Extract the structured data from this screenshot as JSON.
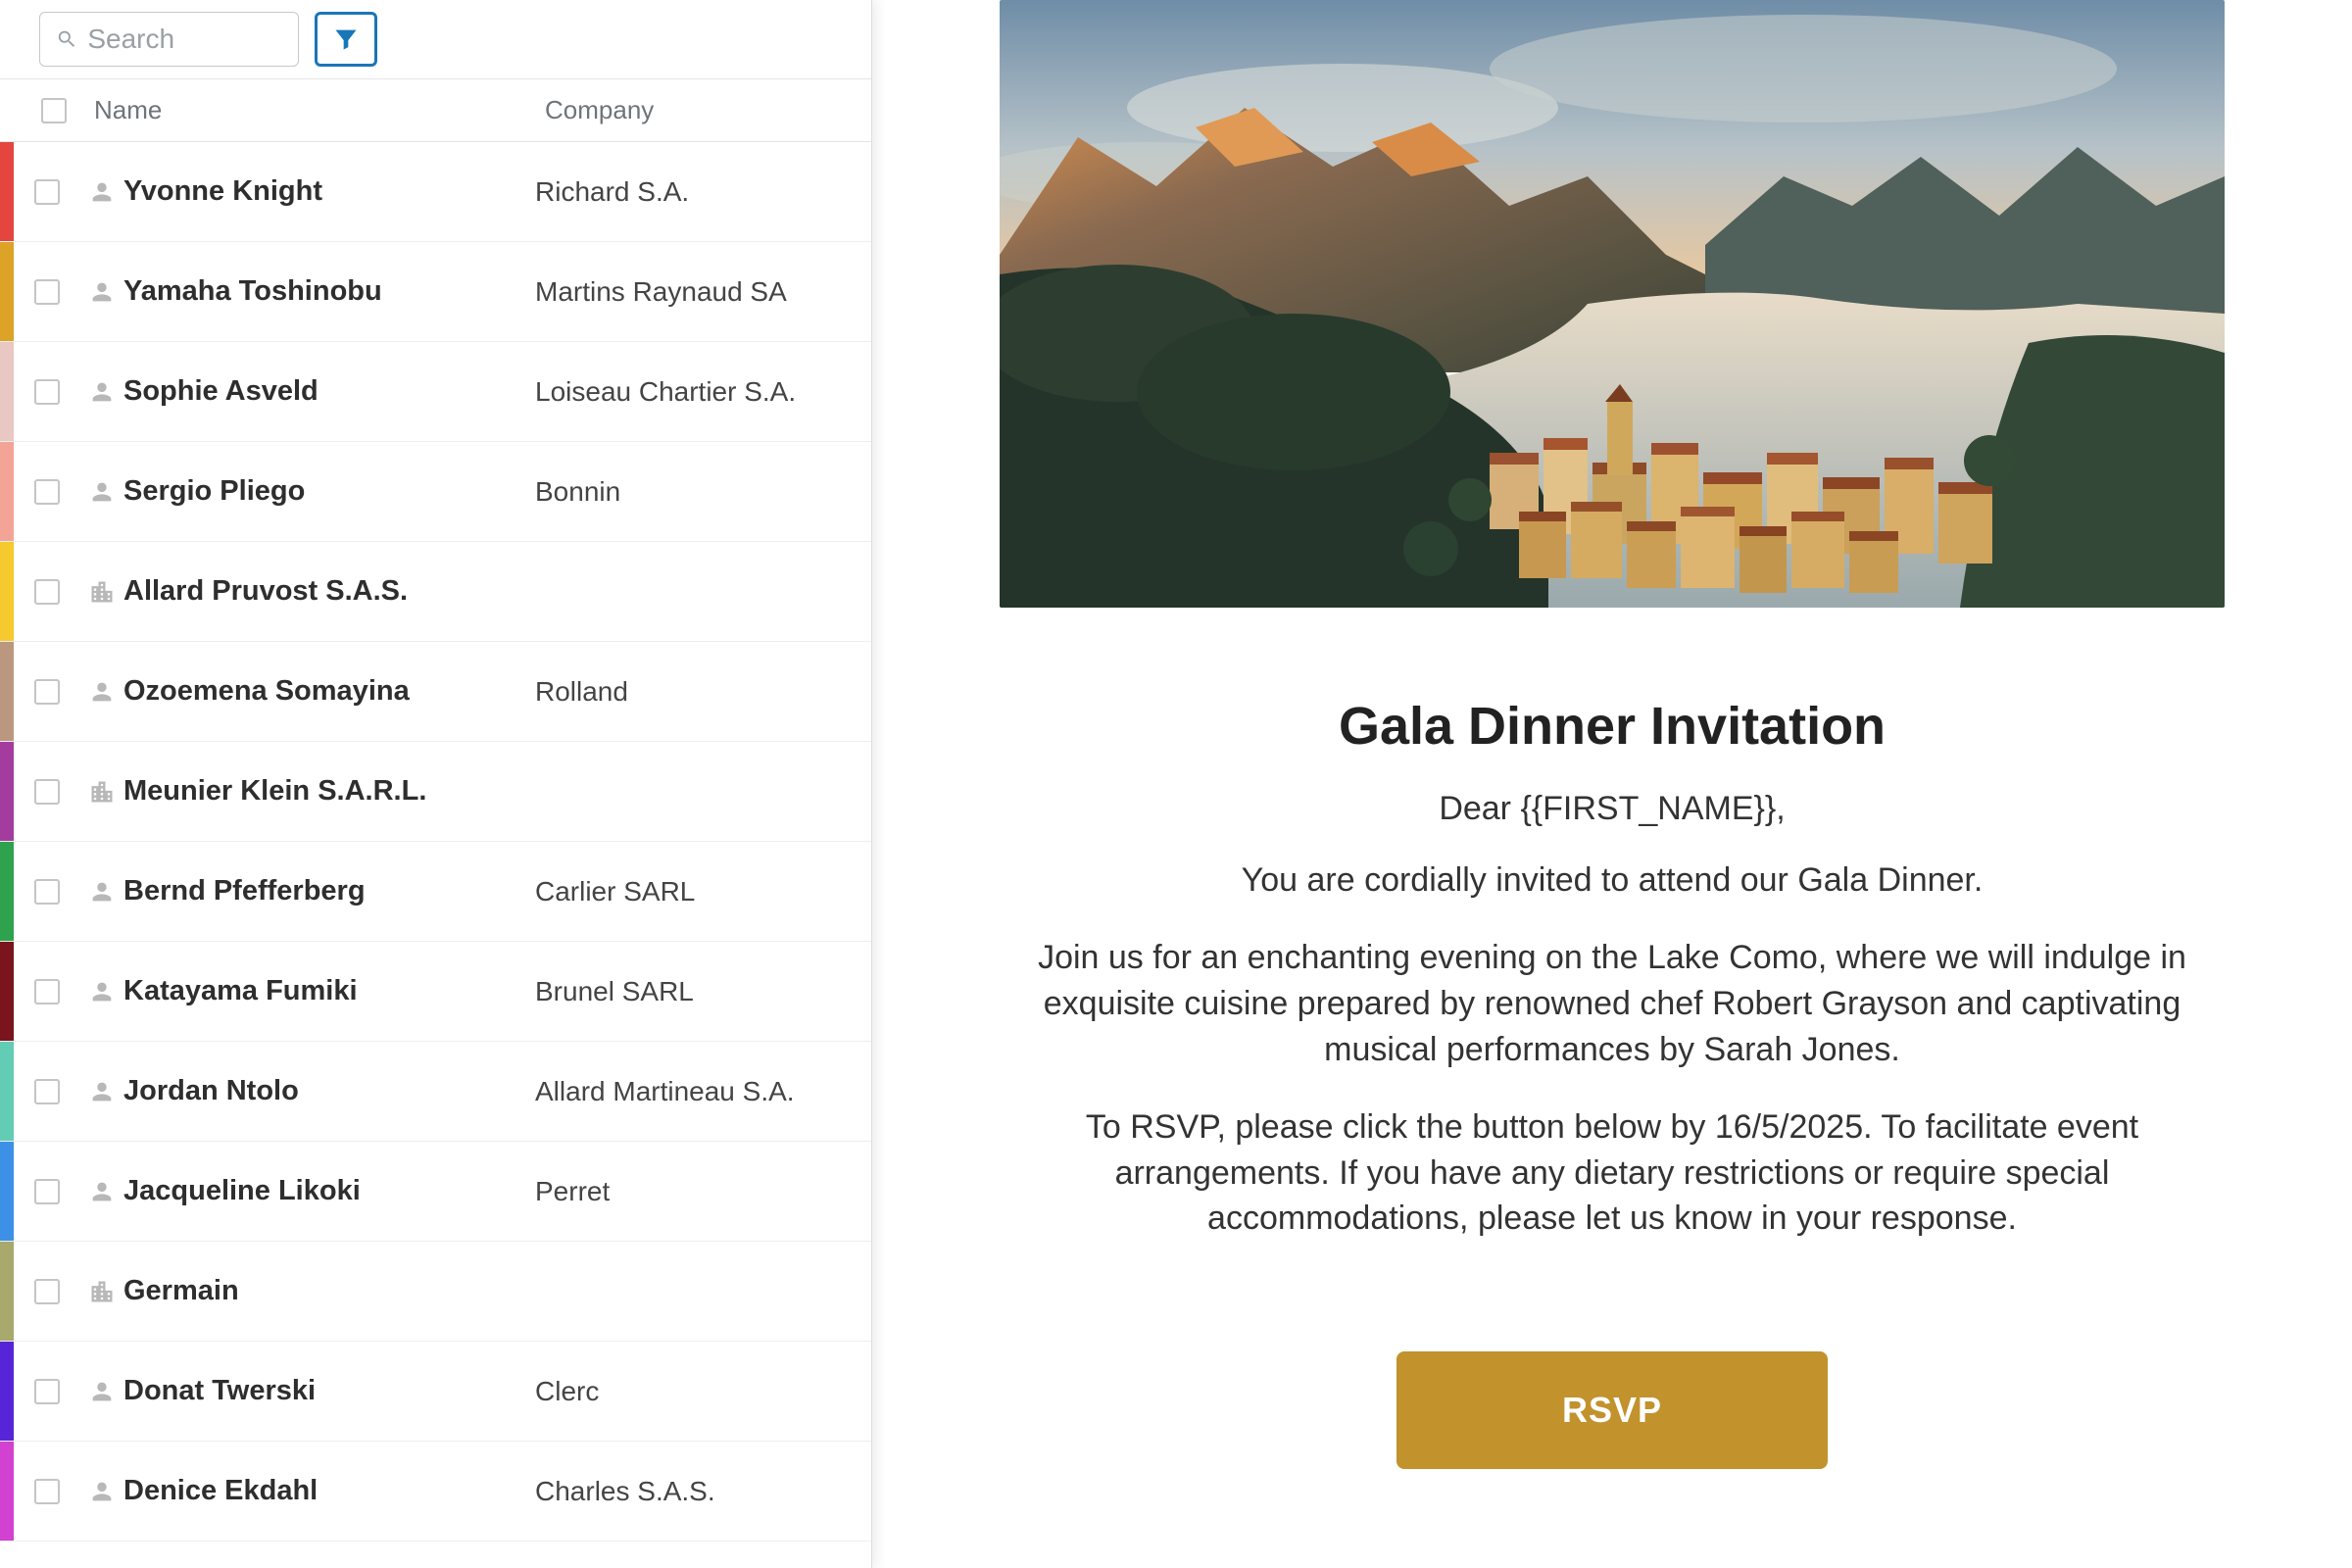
{
  "search": {
    "placeholder": "Search"
  },
  "headers": {
    "name": "Name",
    "company": "Company"
  },
  "contacts": [
    {
      "name": "Yvonne Knight",
      "company": "Richard S.A.",
      "color": "#e4453f",
      "type": "person"
    },
    {
      "name": "Yamaha Toshinobu",
      "company": "Martins Raynaud SA",
      "color": "#dca326",
      "type": "person"
    },
    {
      "name": "Sophie Asveld",
      "company": "Loiseau Chartier S.A.",
      "color": "#e9c7c2",
      "type": "person"
    },
    {
      "name": "Sergio Pliego",
      "company": "Bonnin",
      "color": "#f4a496",
      "type": "person"
    },
    {
      "name": "Allard Pruvost S.A.S.",
      "company": "",
      "color": "#f6c92f",
      "type": "company"
    },
    {
      "name": "Ozoemena Somayina",
      "company": "Rolland",
      "color": "#ba977e",
      "type": "person"
    },
    {
      "name": "Meunier Klein S.A.R.L.",
      "company": "",
      "color": "#a43ca0",
      "type": "company"
    },
    {
      "name": "Bernd Pfefferberg",
      "company": "Carlier SARL",
      "color": "#2fa24d",
      "type": "person"
    },
    {
      "name": "Katayama Fumiki",
      "company": "Brunel SARL",
      "color": "#7a141d",
      "type": "person"
    },
    {
      "name": "Jordan Ntolo",
      "company": "Allard Martineau S.A.",
      "color": "#63ccb5",
      "type": "person"
    },
    {
      "name": "Jacqueline Likoki",
      "company": "Perret",
      "color": "#3c90e6",
      "type": "person"
    },
    {
      "name": "Germain",
      "company": "",
      "color": "#a9a86d",
      "type": "company"
    },
    {
      "name": "Donat Twerski",
      "company": "Clerc",
      "color": "#5625d7",
      "type": "person"
    },
    {
      "name": "Denice Ekdahl",
      "company": "Charles S.A.S.",
      "color": "#d241cf",
      "type": "person"
    }
  ],
  "email": {
    "title": "Gala Dinner Invitation",
    "greeting": "Dear {{FIRST_NAME}},",
    "p1": "You are cordially invited to attend our Gala Dinner.",
    "p2": "Join us for an enchanting evening on the Lake Como, where we will indulge in exquisite cuisine prepared by renowned chef Robert Grayson and captivating musical performances by Sarah Jones.",
    "p3": "To RSVP, please click the button below by 16/5/2025. To facilitate event arrangements. If you have any dietary restrictions or require special accommodations, please let us know in your response.",
    "rsvp": "RSVP"
  }
}
